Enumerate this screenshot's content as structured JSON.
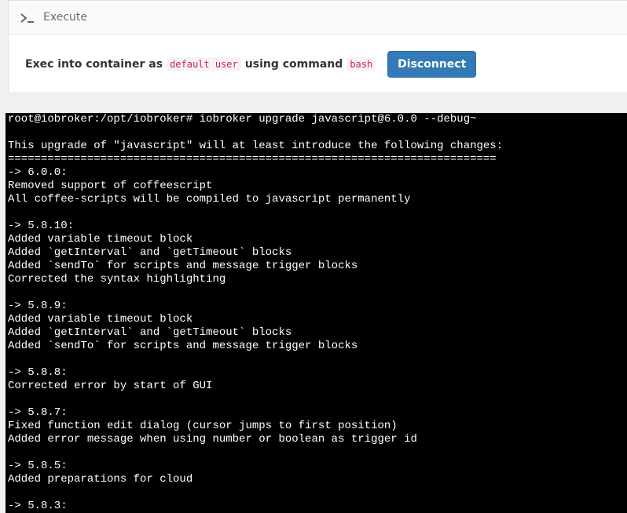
{
  "panel": {
    "title": "Execute",
    "icon": "terminal-prompt-icon",
    "exec_prefix": "Exec into container as",
    "user": "default user",
    "exec_middle": "using command",
    "command": "bash",
    "disconnect_label": "Disconnect"
  },
  "terminal": {
    "lines": [
      "root@iobroker:/opt/iobroker# iobroker upgrade javascript@6.0.0 --debug~",
      "",
      "This upgrade of \"javascript\" will at least introduce the following changes:",
      "==========================================================================",
      "-> 6.0.0:",
      "Removed support of coffeescript",
      "All coffee-scripts will be compiled to javascript permanently",
      "",
      "-> 5.8.10:",
      "Added variable timeout block",
      "Added `getInterval` and `getTimeout` blocks",
      "Added `sendTo` for scripts and message trigger blocks",
      "Corrected the syntax highlighting",
      "",
      "-> 5.8.9:",
      "Added variable timeout block",
      "Added `getInterval` and `getTimeout` blocks",
      "Added `sendTo` for scripts and message trigger blocks",
      "",
      "-> 5.8.8:",
      "Corrected error by start of GUI",
      "",
      "-> 5.8.7:",
      "Fixed function edit dialog (cursor jumps to first position)",
      "Added error message when using number or boolean as trigger id",
      "",
      "-> 5.8.5:",
      "Added preparations for cloud",
      "",
      "-> 5.8.3:"
    ]
  },
  "colors": {
    "button": "#337ab7",
    "code_text": "#c7254e",
    "terminal_bg": "#000000",
    "terminal_fg": "#ffffff"
  }
}
